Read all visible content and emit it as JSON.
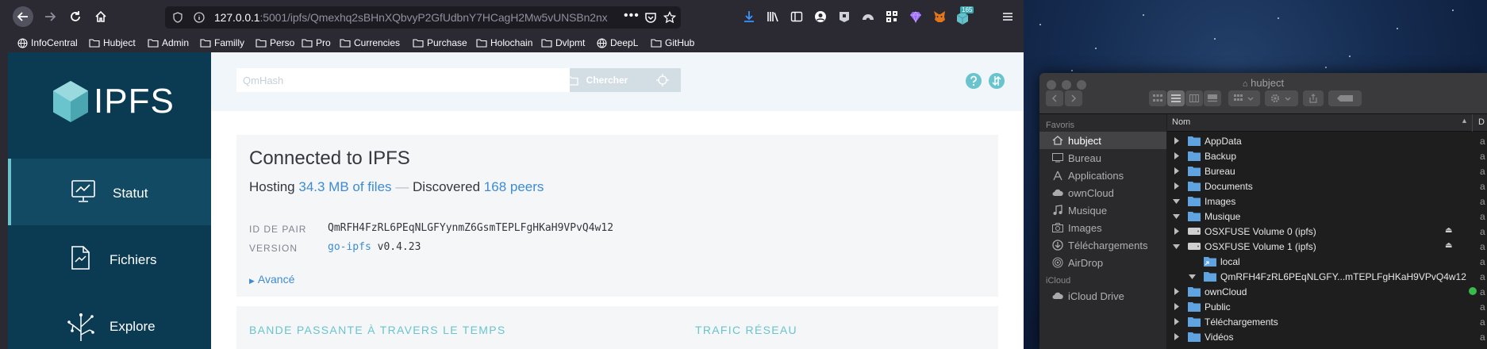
{
  "browser": {
    "url_host": "127.0.0.1",
    "url_rest": ":5001/ipfs/Qmexhq2sBHnXQbvyP2GfUdbnY7HCagH2Mw5vUNSBn2nx",
    "more_icon": "ellipsis-icon",
    "badge_count": "165",
    "bookmarks": [
      "InfoCentral",
      "Hubject",
      "Admin",
      "Familly",
      "Perso",
      "Pro",
      "Currencies",
      "Purchase",
      "Holochain",
      "Dvlpmt",
      "DeepL",
      "GitHub"
    ]
  },
  "ipfs": {
    "logo": "IPFS",
    "nav": [
      {
        "label": "Statut",
        "icon": "monitor-chart-icon"
      },
      {
        "label": "Fichiers",
        "icon": "document-icon"
      },
      {
        "label": "Explore",
        "icon": "tree-icon"
      }
    ],
    "search_placeholder": "QmHash",
    "search_button": "Chercher",
    "title": "Connected to IPFS",
    "hosting_prefix": "Hosting",
    "hosting_files": "34.3 MB of files",
    "dash": "—",
    "discovered": "Discovered",
    "peers": "168 peers",
    "peer_id_label": "ID DE PAIR",
    "peer_id": "QmRFH4FzRL6PEqNLGFYynmZ6GsmTEPLFgHKaH9VPvQ4w12",
    "version_label": "VERSION",
    "version_impl": "go-ipfs",
    "version_num": "v0.4.23",
    "advanced": "Avancé",
    "bandwidth_title": "BANDE PASSANTE À TRAVERS LE TEMPS",
    "traffic_title": "TRAFIC RÉSEAU",
    "accent_color": "#69c4cd",
    "link_color": "#3e8bd3"
  },
  "finder": {
    "title": "hubject",
    "favorites_label": "Favoris",
    "sidebar": [
      "hubject",
      "Bureau",
      "Applications",
      "ownCloud",
      "Musique",
      "Images",
      "Téléchargements",
      "AirDrop"
    ],
    "icloud_label": "iCloud",
    "icloud_drive": "iCloud Drive",
    "column_name": "Nom",
    "column_next": "D",
    "rows": [
      {
        "name": "AppData",
        "trail": "a"
      },
      {
        "name": "Backup",
        "trail": "a"
      },
      {
        "name": "Bureau",
        "trail": "a"
      },
      {
        "name": "Documents",
        "trail": "a"
      },
      {
        "name": "Images",
        "trail": "a"
      },
      {
        "name": "Musique",
        "trail": "a"
      },
      {
        "name": "OSXFUSE Volume 0 (ipfs)",
        "trail": "a"
      },
      {
        "name": "OSXFUSE Volume 1 (ipfs)",
        "trail": "a"
      },
      {
        "name": "local",
        "trail": "a"
      },
      {
        "name": "QmRFH4FzRL6PEqNLGFY...mTEPLFgHKaH9VPvQ4w12",
        "trail": "a"
      },
      {
        "name": "ownCloud",
        "trail": "a"
      },
      {
        "name": "Public",
        "trail": "a"
      },
      {
        "name": "Téléchargements",
        "trail": "a"
      },
      {
        "name": "Vidéos",
        "trail": "a"
      }
    ]
  }
}
